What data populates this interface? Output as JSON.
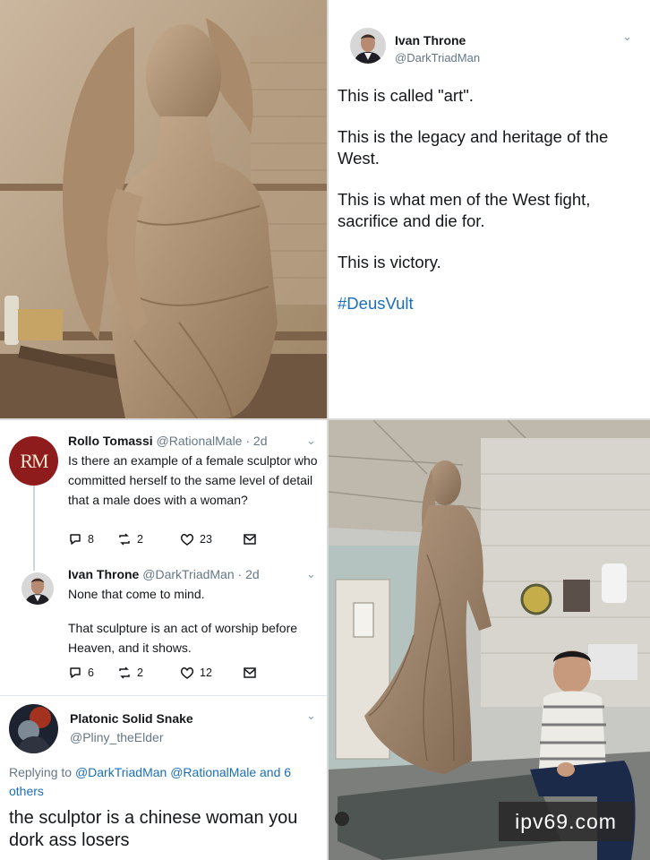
{
  "tweet_main": {
    "name": "Ivan Throne",
    "handle": "@DarkTriadMan",
    "lines": [
      "This is called \"art\".",
      "This is the legacy and heritage of the West.",
      "This is what men of the West fight, sacrifice and die for.",
      "This is victory."
    ],
    "hashtag": "#DeusVult"
  },
  "thread": {
    "reply1": {
      "avatar_text": "RM",
      "name": "Rollo Tomassi",
      "handle_time": "@RationalMale · 2d",
      "text": "Is there an example of a female sculptor who committed herself to the same level of detail that a male does with a woman?",
      "replies": "8",
      "retweets": "2",
      "likes": "23"
    },
    "reply2": {
      "name": "Ivan Throne",
      "handle_time": "@DarkTriadMan · 2d",
      "text1": "None that come to mind.",
      "text2": "That sculpture is an act of worship before Heaven, and it shows.",
      "replies": "6",
      "retweets": "2",
      "likes": "12"
    },
    "reply3": {
      "name": "Platonic Solid Snake",
      "handle": "@Pliny_theElder",
      "replying_prefix": "Replying to",
      "replying_to": "@DarkTriadMan @RationalMale and 6 others",
      "text": "the sculptor is a chinese woman you dork ass losers"
    }
  },
  "watermark": "ipv69.com",
  "colors": {
    "link": "#1b6fb8",
    "muted": "#657786",
    "clay": "#b39a80",
    "avatar_red": "#8e1c1c"
  }
}
